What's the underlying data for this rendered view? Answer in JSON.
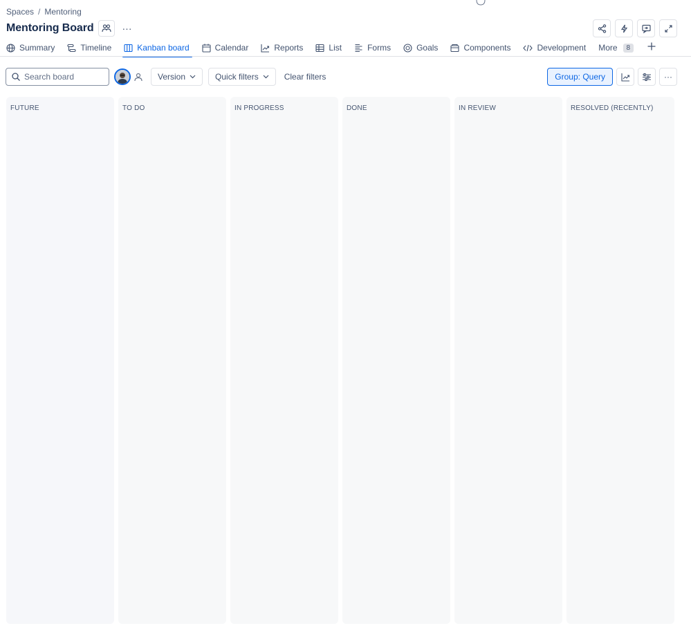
{
  "breadcrumb": {
    "root": "Spaces",
    "separator": "/",
    "current": "Mentoring"
  },
  "page": {
    "title": "Mentoring Board",
    "more_label": "···"
  },
  "tabs": [
    {
      "label": "Summary",
      "icon": "globe-icon",
      "active": false
    },
    {
      "label": "Timeline",
      "icon": "timeline-icon",
      "active": false
    },
    {
      "label": "Kanban board",
      "icon": "board-icon",
      "active": true
    },
    {
      "label": "Calendar",
      "icon": "calendar-icon",
      "active": false
    },
    {
      "label": "Reports",
      "icon": "chart-icon",
      "active": false
    },
    {
      "label": "List",
      "icon": "list-icon",
      "active": false
    },
    {
      "label": "Forms",
      "icon": "forms-icon",
      "active": false
    },
    {
      "label": "Goals",
      "icon": "goal-icon",
      "active": false
    },
    {
      "label": "Components",
      "icon": "components-icon",
      "active": false
    },
    {
      "label": "Development",
      "icon": "code-icon",
      "active": false
    }
  ],
  "more_tab": {
    "label": "More",
    "count": "8"
  },
  "toolbar": {
    "search_placeholder": "Search board",
    "version_label": "Version",
    "quick_filters_label": "Quick filters",
    "clear_filters_label": "Clear filters",
    "group_label": "Group: Query",
    "more_label": "···"
  },
  "columns": [
    {
      "title": "FUTURE"
    },
    {
      "title": "TO DO"
    },
    {
      "title": "IN PROGRESS"
    },
    {
      "title": "DONE"
    },
    {
      "title": "IN REVIEW"
    },
    {
      "title": "RESOLVED (RECENTLY)"
    }
  ],
  "colors": {
    "accent": "#0c66e4",
    "accent_bg": "#e9f2ff",
    "column_bg": "#f7f8f9",
    "border": "#dfe1e6"
  }
}
